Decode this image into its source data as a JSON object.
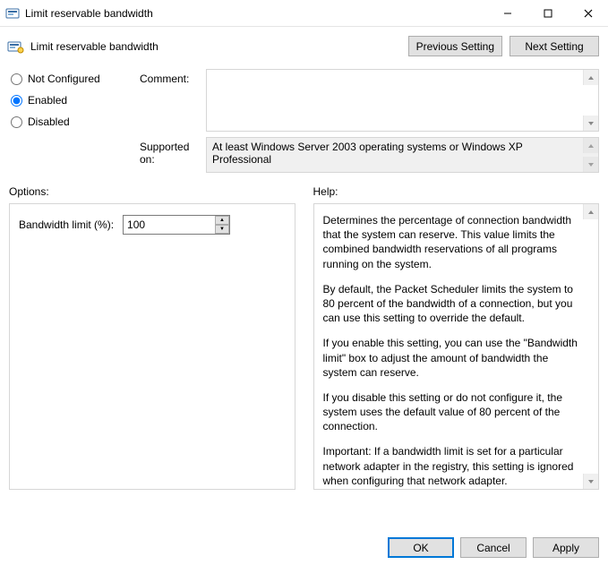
{
  "window": {
    "title": "Limit reservable bandwidth"
  },
  "header": {
    "policy_name": "Limit reservable bandwidth",
    "prev_btn": "Previous Setting",
    "next_btn": "Next Setting"
  },
  "state": {
    "not_configured": "Not Configured",
    "enabled": "Enabled",
    "disabled": "Disabled",
    "selected": "enabled"
  },
  "labels": {
    "comment": "Comment:",
    "supported_on": "Supported on:",
    "options": "Options:",
    "help": "Help:"
  },
  "comment": {
    "value": ""
  },
  "supported": {
    "text": "At least Windows Server 2003 operating systems or Windows XP Professional"
  },
  "options": {
    "bandwidth_label": "Bandwidth limit (%):",
    "bandwidth_value": "100"
  },
  "help": {
    "p1": "Determines the percentage of connection bandwidth that the system can reserve. This value limits the combined bandwidth reservations of all programs running on the system.",
    "p2": "By default, the Packet Scheduler limits the system to 80 percent of the bandwidth of a connection, but you can use this setting to override the default.",
    "p3": "If you enable this setting, you can use the \"Bandwidth limit\" box to adjust the amount of bandwidth the system can reserve.",
    "p4": "If you disable this setting or do not configure it, the system uses the default value of 80 percent of the connection.",
    "p5": "Important: If a bandwidth limit is set for a particular network adapter in the registry, this setting is ignored when configuring that network adapter."
  },
  "footer": {
    "ok": "OK",
    "cancel": "Cancel",
    "apply": "Apply"
  }
}
